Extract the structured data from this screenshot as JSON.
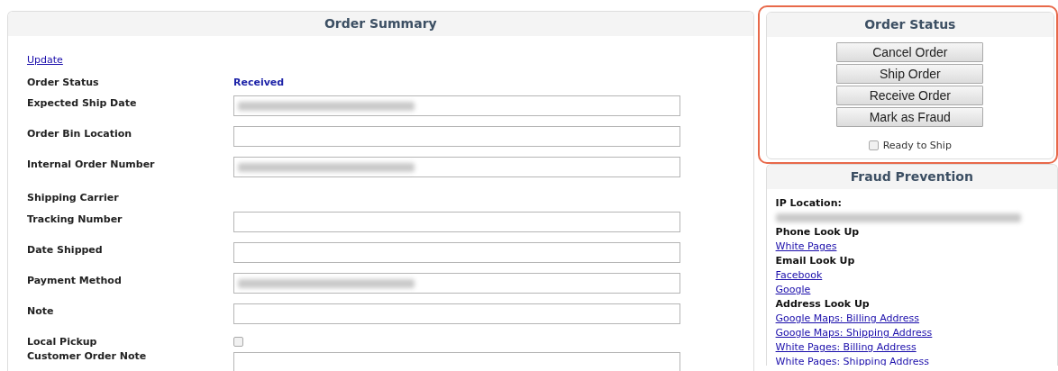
{
  "order_summary": {
    "title": "Order Summary",
    "rows": [
      {
        "kind": "link",
        "text": "Update"
      },
      {
        "kind": "status",
        "label": "Order Status",
        "value": "Received"
      },
      {
        "kind": "input",
        "label": "Expected Ship Date",
        "blurred": true
      },
      {
        "kind": "input",
        "label": "Order Bin Location",
        "blurred": false
      },
      {
        "kind": "input",
        "label": "Internal Order Number",
        "blurred": true
      },
      {
        "kind": "label",
        "label": "Shipping Carrier"
      },
      {
        "kind": "input",
        "label": "Tracking Number",
        "blurred": false
      },
      {
        "kind": "input",
        "label": "Date Shipped",
        "blurred": false
      },
      {
        "kind": "input",
        "label": "Payment Method",
        "blurred": true
      },
      {
        "kind": "input",
        "label": "Note",
        "blurred": false
      },
      {
        "kind": "checkbox",
        "label": "Local Pickup",
        "checked": false
      },
      {
        "kind": "input",
        "label": "Customer Order Note"
      }
    ]
  },
  "order_status": {
    "title": "Order Status",
    "highlighted": true,
    "buttons": [
      "Cancel Order",
      "Ship Order",
      "Receive Order",
      "Mark as Fraud"
    ],
    "ready_to_ship": {
      "label": "Ready to Ship",
      "checked": false
    }
  },
  "fraud_prevention": {
    "title": "Fraud Prevention",
    "items": [
      {
        "kind": "heading",
        "text": "IP Location:"
      },
      {
        "kind": "blurred"
      },
      {
        "kind": "heading",
        "text": "Phone Look Up"
      },
      {
        "kind": "link",
        "text": "White Pages"
      },
      {
        "kind": "heading",
        "text": "Email Look Up"
      },
      {
        "kind": "link",
        "text": "Facebook"
      },
      {
        "kind": "link",
        "text": "Google"
      },
      {
        "kind": "heading",
        "text": "Address Look Up"
      },
      {
        "kind": "link",
        "text": "Google Maps: Billing Address"
      },
      {
        "kind": "link",
        "text": "Google Maps: Shipping Address"
      },
      {
        "kind": "link",
        "text": "White Pages: Billing Address"
      },
      {
        "kind": "link",
        "text": "White Pages: Shipping Address"
      }
    ]
  }
}
